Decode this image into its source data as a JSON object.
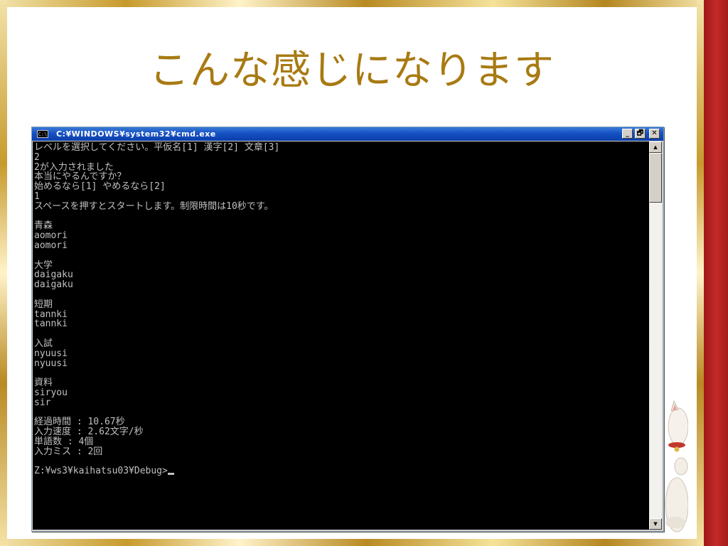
{
  "slide": {
    "title": "こんな感じになります"
  },
  "window": {
    "icon_label": "C:\\",
    "title": "C:¥WINDOWS¥system32¥cmd.exe",
    "minimize_label": "_",
    "maximize_label": "🗗",
    "close_label": "✕"
  },
  "console": {
    "lines": [
      "レベルを選択してください。平仮名[1] 漢字[2] 文章[3]",
      "2",
      "2が入力されました",
      "本当にやるんですか？",
      "始めるなら[1] やめるなら[2]",
      "1",
      "スペースを押すとスタートします。制限時間は10秒です。",
      "",
      "青森",
      "aomori",
      "aomori",
      "",
      "大学",
      "daigaku",
      "daigaku",
      "",
      "短期",
      "tannki",
      "tannki",
      "",
      "入試",
      "nyuusi",
      "nyuusi",
      "",
      "資料",
      "siryou",
      "sir",
      "",
      "経過時間 : 10.67秒",
      "入力速度 : 2.62文字/秒",
      "単語数 : 4個",
      "入力ミス : 2回",
      "",
      "Z:¥ws3¥kaihatsu03¥Debug>"
    ]
  },
  "scrollbar": {
    "up_arrow": "▲",
    "down_arrow": "▼"
  }
}
